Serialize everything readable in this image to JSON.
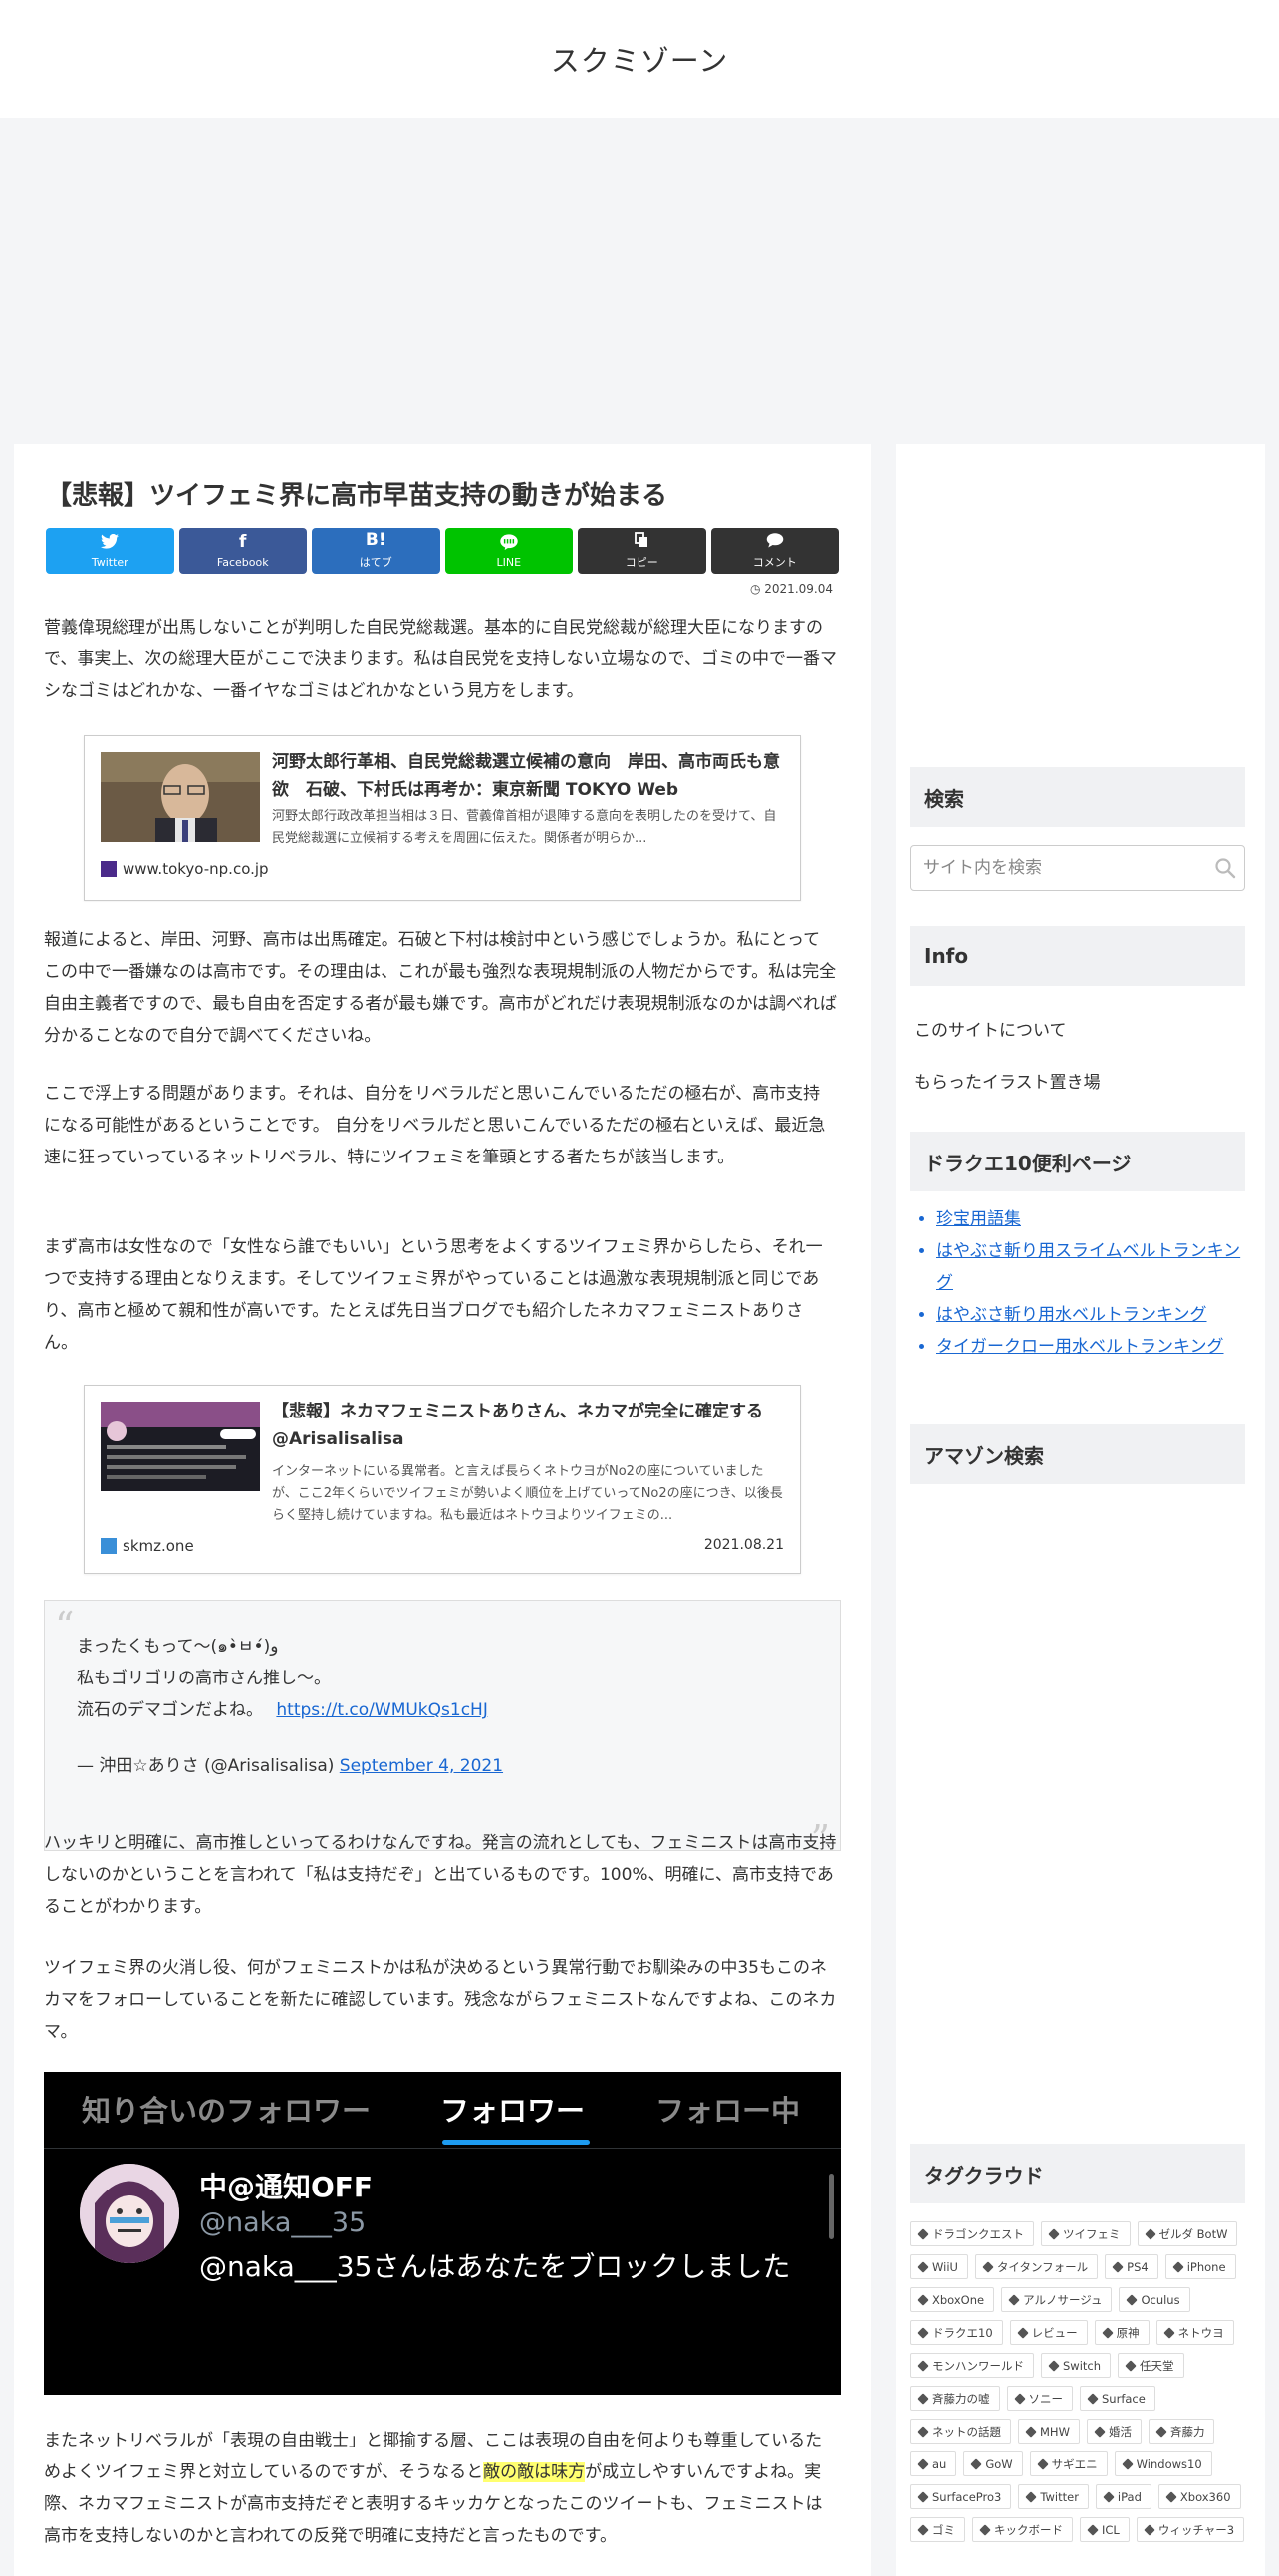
{
  "site": {
    "title": "スクミゾーン"
  },
  "article": {
    "title": "【悲報】ツイフェミ界に高市早苗支持の動きが始まる",
    "date": "2021.09.04",
    "share": [
      {
        "icon": "twitter-icon",
        "label": "Twitter",
        "color": "#1da1f2"
      },
      {
        "icon": "facebook-icon",
        "label": "Facebook",
        "color": "#3b5998"
      },
      {
        "icon": "hatena-icon",
        "label": "はてブ",
        "color": "#2c6ebd"
      },
      {
        "icon": "line-icon",
        "label": "LINE",
        "color": "#00c300"
      },
      {
        "icon": "copy-icon",
        "label": "コピー",
        "color": "#333333"
      },
      {
        "icon": "comment-icon",
        "label": "コメント",
        "color": "#333333"
      }
    ],
    "p1": "菅義偉現総理が出馬しないことが判明した自民党総裁選。基本的に自民党総裁が総理大臣になりますので、事実上、次の総理大臣がここで決まります。私は自民党を支持しない立場なので、ゴミの中で一番マシなゴミはどれかな、一番イヤなゴミはどれかなという見方をします。",
    "card1": {
      "title": "河野太郎行革相、自民党総裁選立候補の意向　岸田、高市両氏も意欲　石破、下村氏は再考か：東京新聞 TOKYO Web",
      "desc": "河野太郎行政改革担当相は３日、菅義偉首相が退陣する意向を表明したのを受けて、自民党総裁選に立候補する考えを周囲に伝えた。関係者が明らか...",
      "site": "www.tokyo-np.co.jp"
    },
    "p2": "報道によると、岸田、河野、高市は出馬確定。石破と下村は検討中という感じでしょうか。私にとってこの中で一番嫌なのは高市です。その理由は、これが最も強烈な表現規制派の人物だからです。私は完全自由主義者ですので、最も自由を否定する者が最も嫌です。高市がどれだけ表現規制派なのかは調べれば分かることなので自分で調べてくださいね。",
    "p3": "ここで浮上する問題があります。それは、自分をリベラルだと思いこんでいるただの極右が、高市支持になる可能性があるということです。 自分をリベラルだと思いこんでいるただの極右といえば、最近急速に狂っていっているネットリベラル、特にツイフェミを筆頭とする者たちが該当します。",
    "p4": "まず高市は女性なので「女性なら誰でもいい」という思考をよくするツイフェミ界からしたら、それ一つで支持する理由となりえます。そしてツイフェミ界がやっていることは過激な表現規制派と同じであり、高市と極めて親和性が高いです。たとえば先日当ブログでも紹介したネカマフェミニストありさん。",
    "card2": {
      "title": "【悲報】ネカマフェミニストありさん、ネカマが完全に確定する @Arisalisalisa",
      "desc": "インターネットにいる異常者。と言えば長らくネトウヨがNo2の座についていましたが、ここ2年くらいでツイフェミが勢いよく順位を上げていってNo2の座につき、以後長らく堅持し続けていますね。私も最近はネトウヨよりツイフェミの...",
      "site": "skmz.one",
      "date": "2021.08.21"
    },
    "tweet": {
      "line1": "まったくもって〜(๑•̀ㅂ•́)و",
      "line2": "私もゴリゴリの高市さん推し〜。",
      "line3": "流石のデマゴンだよね。",
      "link": "https://t.co/WMUkQs1cHJ",
      "author": "— 沖田☆ありさ (@Arisalisalisa)",
      "date": "September 4, 2021"
    },
    "p5": "ハッキリと明確に、高市推しといってるわけなんですね。発言の流れとしても、フェミニストは高市支持しないのかということを言われて「私は支持だぞ」と出ているものです。100%、明確に、高市支持であることがわかります。",
    "p6": "ツイフェミ界の火消し役、何がフェミニストかは私が決めるという異常行動でお馴染みの中35もこのネカマをフォローしていることを新たに確認しています。残念ながらフェミニストなんですよね、このネカマ。",
    "screenshot": {
      "tab1": "知り合いのフォロワー",
      "tab2": "フォロワー",
      "tab3": "フォロー中",
      "name": "中@通知OFF",
      "handle": "@naka___35",
      "message": "@naka___35さんはあなたをブロックしました"
    },
    "p7a": "またネットリベラルが「表現の自由戦士」と揶揄する層、ここは表現の自由を何よりも尊重しているためよくツイフェミ界と対立しているのですが、そうなると",
    "p7hl": "敵の敵は味方",
    "p7b": "が成立しやすいんですよね。実際、ネカマフェミニストが高市支持だぞと表明するキッカケとなったこのツイートも、フェミニストは高市を支持しないのかと言われての反発で明確に支持だと言ったものです。"
  },
  "sidebar": {
    "search": {
      "heading": "検索",
      "placeholder": "サイト内を検索"
    },
    "info": {
      "heading": "Info",
      "links": [
        "このサイトについて",
        "もらったイラスト置き場"
      ]
    },
    "dq": {
      "heading": "ドラクエ10便利ページ",
      "links": [
        "珍宝用語集",
        "はやぶさ斬り用スライムベルトランキング",
        "はやぶさ斬り用水ベルトランキング",
        "タイガークロー用水ベルトランキング"
      ]
    },
    "amazon": {
      "heading": "アマゾン検索"
    },
    "tags": {
      "heading": "タグクラウド",
      "items": [
        "ドラゴンクエスト",
        "ツイフェミ",
        "ゼルダ BotW",
        "WiiU",
        "タイタンフォール",
        "PS4",
        "iPhone",
        "XboxOne",
        "アルノサージュ",
        "Oculus",
        "ドラクエ10",
        "レビュー",
        "原神",
        "ネトウヨ",
        "モンハンワールド",
        "Switch",
        "任天堂",
        "斉藤力の嘘",
        "ソニー",
        "Surface",
        "ネットの話題",
        "MHW",
        "婚活",
        "斉藤力",
        "au",
        "GoW",
        "サギエニ",
        "Windows10",
        "SurfacePro3",
        "Twitter",
        "iPad",
        "Xbox360",
        "ゴミ",
        "キックボード",
        "ICL",
        "ウィッチャー3"
      ]
    }
  }
}
